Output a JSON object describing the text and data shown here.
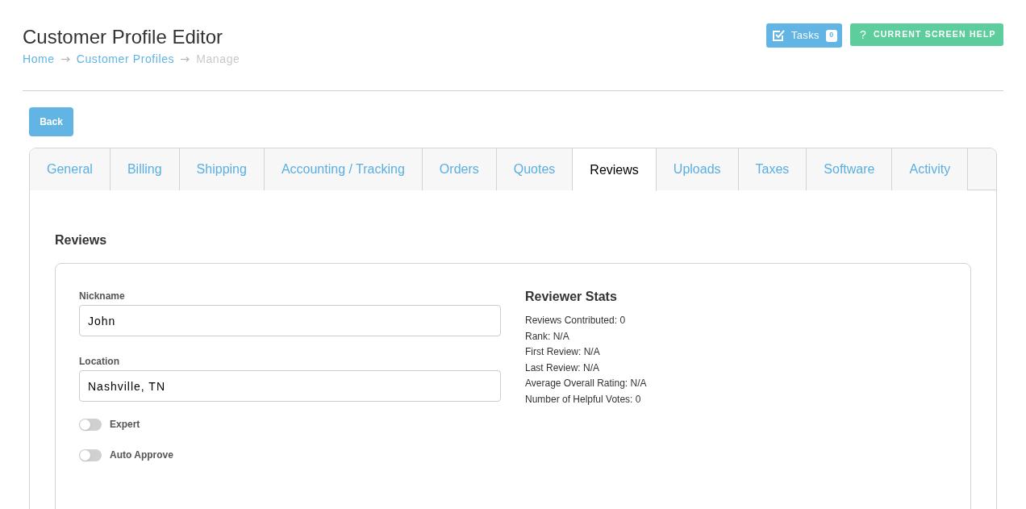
{
  "header": {
    "title": "Customer Profile Editor",
    "breadcrumbs": [
      {
        "label": "Home",
        "kind": "link"
      },
      {
        "label": "Customer Profiles",
        "kind": "link"
      },
      {
        "label": "Manage",
        "kind": "current"
      }
    ],
    "tasks_button": {
      "label": "Tasks",
      "count": "0"
    },
    "help_button": {
      "icon": "?",
      "label": "CURRENT SCREEN HELP"
    }
  },
  "back_button": {
    "label": "Back"
  },
  "tabs": [
    {
      "label": "General",
      "selected": false
    },
    {
      "label": "Billing",
      "selected": false
    },
    {
      "label": "Shipping",
      "selected": false
    },
    {
      "label": "Accounting / Tracking",
      "selected": false
    },
    {
      "label": "Orders",
      "selected": false
    },
    {
      "label": "Quotes",
      "selected": false
    },
    {
      "label": "Reviews",
      "selected": true
    },
    {
      "label": "Uploads",
      "selected": false
    },
    {
      "label": "Taxes",
      "selected": false
    },
    {
      "label": "Software",
      "selected": false
    },
    {
      "label": "Activity",
      "selected": false
    }
  ],
  "panel": {
    "title": "Reviews",
    "fields": [
      {
        "label": "Nickname",
        "value": "John"
      },
      {
        "label": "Location",
        "value": "Nashville, TN"
      }
    ],
    "toggles": [
      {
        "label": "Expert",
        "on": false
      },
      {
        "label": "Auto Approve",
        "on": false
      }
    ],
    "stats": {
      "title": "Reviewer Stats",
      "lines": [
        "Reviews Contributed: 0",
        "Rank: N/A",
        "First Review: N/A",
        "Last Review: N/A",
        "Average Overall Rating: N/A",
        "Number of Helpful Votes: 0"
      ]
    }
  }
}
